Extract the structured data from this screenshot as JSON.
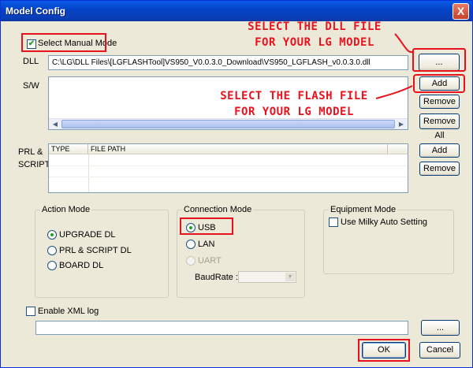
{
  "window": {
    "title": "Model Config",
    "close": "X"
  },
  "manual_mode": {
    "label": "Select Manual Mode",
    "checked": true
  },
  "dll": {
    "label": "DLL",
    "path": "C:\\LG\\DLL Files\\[LGFLASHTool]VS950_V0.0.3.0_Download\\VS950_LGFLASH_v0.0.3.0.dll",
    "browse": "..."
  },
  "sw": {
    "label": "S/W",
    "add": "Add",
    "remove": "Remove",
    "remove_all": "Remove All"
  },
  "prl": {
    "label_line1": "PRL   &",
    "label_line2": "SCRIPT",
    "columns": [
      "TYPE",
      "FILE PATH"
    ],
    "add": "Add",
    "remove": "Remove"
  },
  "action_mode": {
    "title": "Action Mode",
    "options": [
      "UPGRADE DL",
      "PRL & SCRIPT DL",
      "BOARD DL"
    ],
    "selected": 0
  },
  "connection_mode": {
    "title": "Connection Mode",
    "options": [
      "USB",
      "LAN",
      "UART"
    ],
    "selected": 0,
    "baud_label": "BaudRate :"
  },
  "equipment_mode": {
    "title": "Equipment Mode",
    "milky_label": "Use Milky Auto Setting"
  },
  "xml_log": {
    "label": "Enable XML log",
    "browse": "..."
  },
  "footer": {
    "ok": "OK",
    "cancel": "Cancel"
  },
  "annotations": {
    "dll_line1": "SELECT THE DLL FILE",
    "dll_line2": "FOR YOUR LG MODEL",
    "flash_line1": "SELECT THE FLASH FILE",
    "flash_line2": "FOR YOUR LG MODEL",
    "color": "#e8121e"
  },
  "colors": {
    "title_bar": "#0542c4",
    "dialog_bg": "#ece9d8",
    "check_mark": "#21a121"
  }
}
